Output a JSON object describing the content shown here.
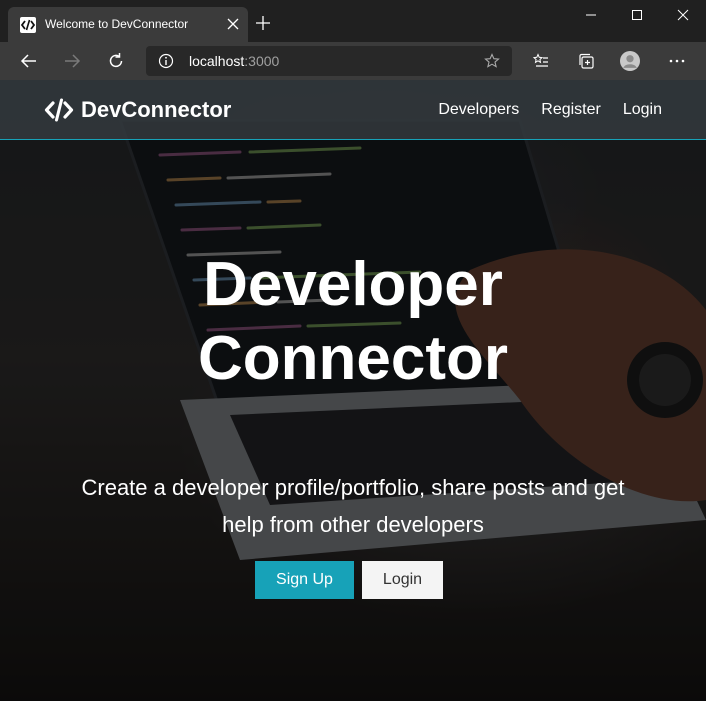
{
  "browser": {
    "tab_title": "Welcome to DevConnector",
    "url_host": "localhost",
    "url_port": ":3000"
  },
  "navbar": {
    "brand": "DevConnector",
    "links": [
      "Developers",
      "Register",
      "Login"
    ]
  },
  "landing": {
    "title_line1": "Developer",
    "title_line2": "Connector",
    "lead": "Create a developer profile/portfolio, share posts and get help from other developers",
    "signup_label": "Sign Up",
    "login_label": "Login"
  },
  "colors": {
    "primary": "#17a2b8",
    "navbar_bg": "#343a40",
    "light_button": "#f4f4f4"
  }
}
